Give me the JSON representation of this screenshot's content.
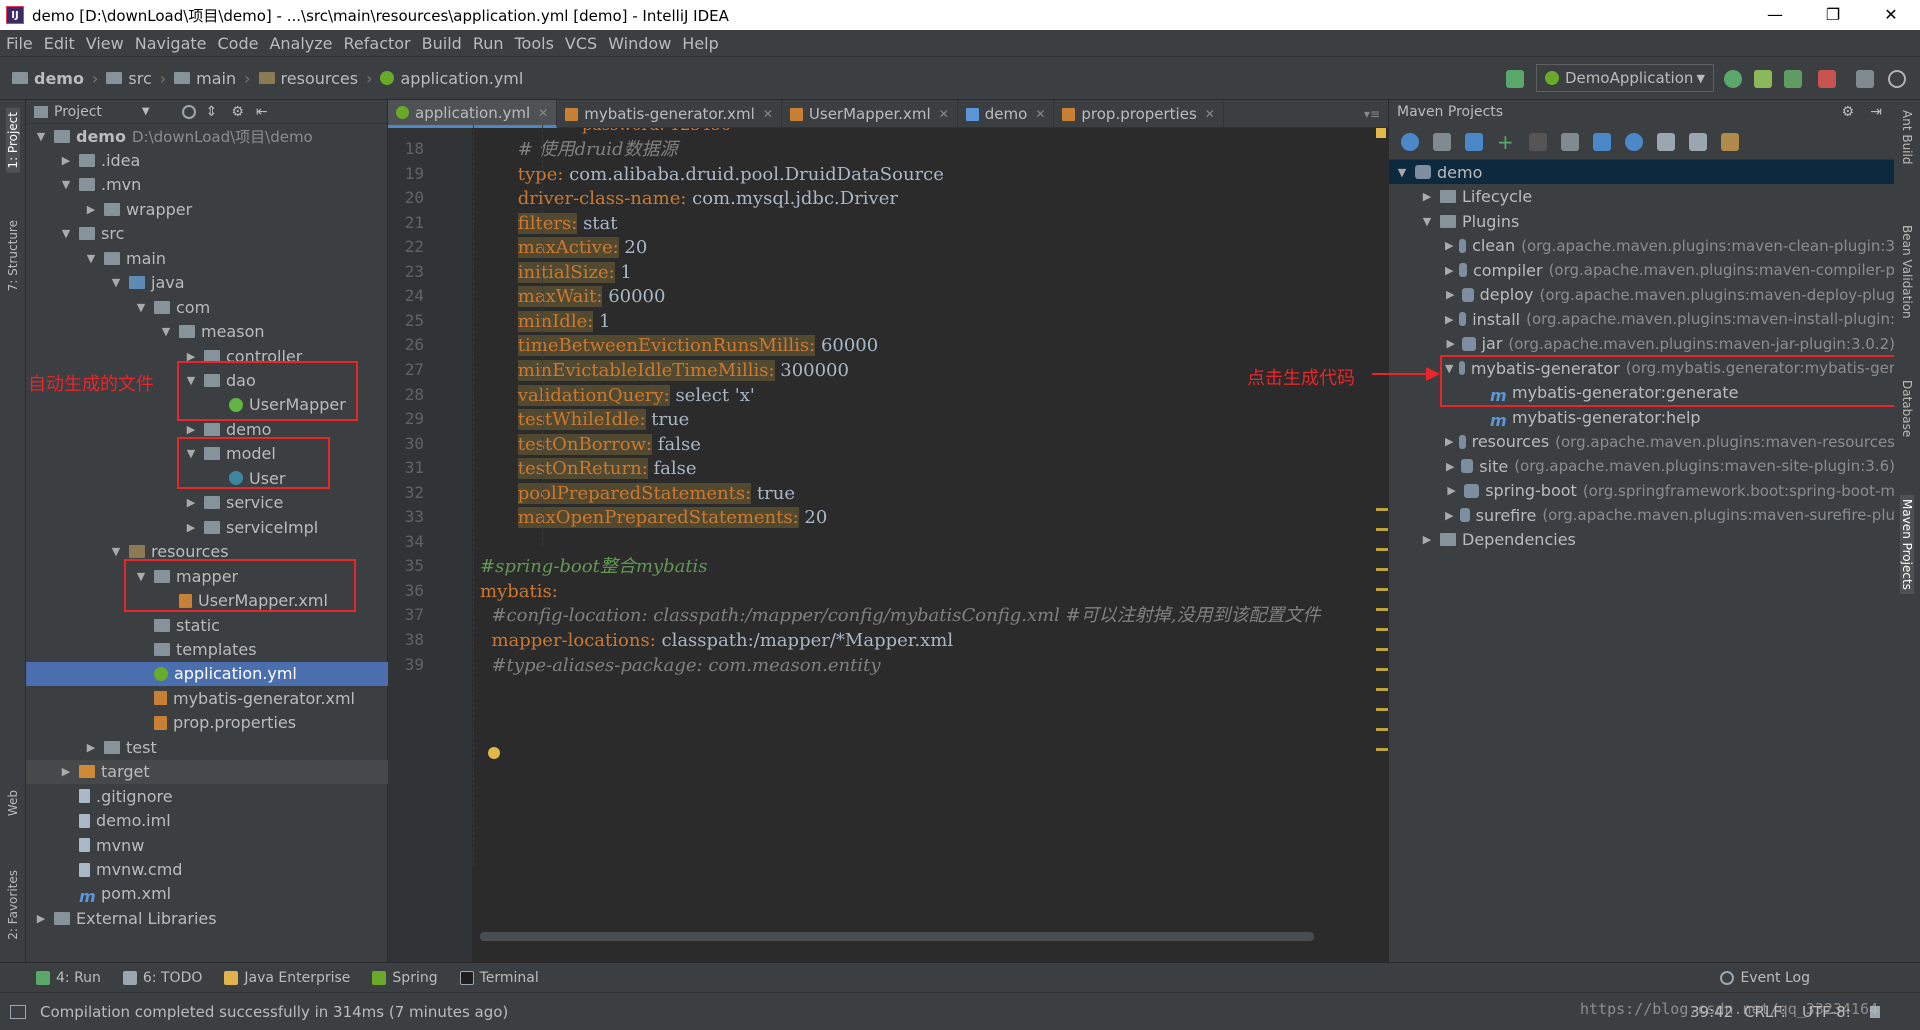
{
  "window": {
    "title": "demo [D:\\downLoad\\项目\\demo] - ...\\src\\main\\resources\\application.yml [demo] - IntelliJ IDEA",
    "controls": [
      "—",
      "❐",
      "✕"
    ]
  },
  "menu": [
    "File",
    "Edit",
    "View",
    "Navigate",
    "Code",
    "Analyze",
    "Refactor",
    "Build",
    "Run",
    "Tools",
    "VCS",
    "Window",
    "Help"
  ],
  "breadcrumb": [
    "demo",
    "src",
    "main",
    "resources",
    "application.yml"
  ],
  "run_config": "DemoApplication",
  "left_stripe": [
    "1: Project",
    "7: Structure",
    "Web",
    "2: Favorites"
  ],
  "project": {
    "header": "Project",
    "tree": [
      {
        "label": "demo",
        "extra": "D:\\downLoad\\项目\\demo",
        "arrow": "▼",
        "icon": "folder"
      },
      {
        "label": ".idea",
        "arrow": "▶",
        "icon": "folder"
      },
      {
        "label": ".mvn",
        "arrow": "▼",
        "icon": "folder"
      },
      {
        "label": "wrapper",
        "arrow": "▶",
        "icon": "folder"
      },
      {
        "label": "src",
        "arrow": "▼",
        "icon": "folder"
      },
      {
        "label": "main",
        "arrow": "▼",
        "icon": "folder"
      },
      {
        "label": "java",
        "arrow": "▼",
        "icon": "src"
      },
      {
        "label": "com",
        "arrow": "▼",
        "icon": "folder"
      },
      {
        "label": "meason",
        "arrow": "▼",
        "icon": "folder"
      },
      {
        "label": "controller",
        "arrow": "▶",
        "icon": "folder"
      },
      {
        "label": "dao",
        "arrow": "▼",
        "icon": "folder"
      },
      {
        "label": "UserMapper",
        "arrow": "",
        "icon": "iface"
      },
      {
        "label": "demo",
        "arrow": "▶",
        "icon": "folder"
      },
      {
        "label": "model",
        "arrow": "▼",
        "icon": "folder"
      },
      {
        "label": "User",
        "arrow": "",
        "icon": "class"
      },
      {
        "label": "service",
        "arrow": "▶",
        "icon": "folder"
      },
      {
        "label": "serviceImpl",
        "arrow": "▶",
        "icon": "folder"
      },
      {
        "label": "resources",
        "arrow": "▼",
        "icon": "res"
      },
      {
        "label": "mapper",
        "arrow": "▼",
        "icon": "folder"
      },
      {
        "label": "UserMapper.xml",
        "arrow": "",
        "icon": "xml"
      },
      {
        "label": "static",
        "arrow": "",
        "icon": "folder"
      },
      {
        "label": "templates",
        "arrow": "",
        "icon": "folder"
      },
      {
        "label": "application.yml",
        "arrow": "",
        "icon": "yml"
      },
      {
        "label": "mybatis-generator.xml",
        "arrow": "",
        "icon": "xml"
      },
      {
        "label": "prop.properties",
        "arrow": "",
        "icon": "xml"
      },
      {
        "label": "test",
        "arrow": "▶",
        "icon": "folder"
      },
      {
        "label": "target",
        "arrow": "▶",
        "icon": "target"
      },
      {
        "label": ".gitignore",
        "arrow": "",
        "icon": "file"
      },
      {
        "label": "demo.iml",
        "arrow": "",
        "icon": "file"
      },
      {
        "label": "mvnw",
        "arrow": "",
        "icon": "file"
      },
      {
        "label": "mvnw.cmd",
        "arrow": "",
        "icon": "file"
      },
      {
        "label": "pom.xml",
        "arrow": "",
        "icon": "m"
      },
      {
        "label": "External Libraries",
        "arrow": "▶",
        "icon": "lib"
      }
    ]
  },
  "annotations": {
    "left_note": "自动生成的文件",
    "right_note": "点击生成代码"
  },
  "editor": {
    "tabs": [
      {
        "label": "application.yml",
        "active": true
      },
      {
        "label": "mybatis-generator.xml",
        "active": false
      },
      {
        "label": "UserMapper.xml",
        "active": false
      },
      {
        "label": "demo",
        "active": false
      },
      {
        "label": "prop.properties",
        "active": false
      }
    ],
    "partial_top_line": "password: 123456",
    "line_numbers": [
      "18",
      "19",
      "20",
      "21",
      "22",
      "23",
      "24",
      "25",
      "26",
      "27",
      "28",
      "29",
      "30",
      "31",
      "32",
      "33",
      "34",
      "35",
      "36",
      "37",
      "38",
      "39"
    ],
    "lines": [
      {
        "indent": "        ",
        "comment": "# 使用druid数据源"
      },
      {
        "indent": "        ",
        "key": "type:",
        "value": " com.alibaba.druid.pool.DruidDataSource"
      },
      {
        "indent": "        ",
        "key": "driver-class-name:",
        "value": " com.mysql.jdbc.Driver"
      },
      {
        "indent": "        ",
        "key": "filters:",
        "value": " stat"
      },
      {
        "indent": "        ",
        "key": "maxActive:",
        "value": " 20"
      },
      {
        "indent": "        ",
        "key": "initialSize:",
        "value": " 1"
      },
      {
        "indent": "        ",
        "key": "maxWait:",
        "value": " 60000"
      },
      {
        "indent": "        ",
        "key": "minIdle:",
        "value": " 1"
      },
      {
        "indent": "        ",
        "key": "timeBetweenEvictionRunsMillis:",
        "value": " 60000"
      },
      {
        "indent": "        ",
        "key": "minEvictableIdleTimeMillis:",
        "value": " 300000"
      },
      {
        "indent": "        ",
        "key": "validationQuery:",
        "value": " select 'x'"
      },
      {
        "indent": "        ",
        "key": "testWhileIdle:",
        "value": " true"
      },
      {
        "indent": "        ",
        "key": "testOnBorrow:",
        "value": " false"
      },
      {
        "indent": "        ",
        "key": "testOnReturn:",
        "value": " false"
      },
      {
        "indent": "        ",
        "key": "poolPreparedStatements:",
        "value": " true"
      },
      {
        "indent": "        ",
        "key": "maxOpenPreparedStatements:",
        "value": " 20"
      },
      {
        "indent": "",
        "value": ""
      },
      {
        "indent": "",
        "comment": "#spring-boot整合mybatis"
      },
      {
        "indent": "",
        "key": "mybatis:",
        "value": ""
      },
      {
        "indent": "  ",
        "comment": "#config-location: classpath:/mapper/config/mybatisConfig.xml #可以注射掉,没用到该配置文件"
      },
      {
        "indent": "  ",
        "key": "mapper-locations:",
        "value": " classpath:/mapper/*Mapper.xml"
      },
      {
        "indent": "  ",
        "comment": "#type-aliases-package: com.meason.entity"
      }
    ]
  },
  "maven": {
    "header": "Maven Projects",
    "tree": [
      {
        "label": "demo",
        "arrow": "▼",
        "dim": ""
      },
      {
        "label": "Lifecycle",
        "arrow": "▶",
        "dim": ""
      },
      {
        "label": "Plugins",
        "arrow": "▼",
        "dim": ""
      },
      {
        "label": "clean",
        "arrow": "▶",
        "dim": "(org.apache.maven.plugins:maven-clean-plugin:3"
      },
      {
        "label": "compiler",
        "arrow": "▶",
        "dim": "(org.apache.maven.plugins:maven-compiler-p"
      },
      {
        "label": "deploy",
        "arrow": "▶",
        "dim": "(org.apache.maven.plugins:maven-deploy-plug"
      },
      {
        "label": "install",
        "arrow": "▶",
        "dim": "(org.apache.maven.plugins:maven-install-plugin:"
      },
      {
        "label": "jar",
        "arrow": "▶",
        "dim": "(org.apache.maven.plugins:maven-jar-plugin:3.0.2)"
      },
      {
        "label": "mybatis-generator",
        "arrow": "▼",
        "dim": "(org.mybatis.generator:mybatis-ger"
      },
      {
        "label": "mybatis-generator:generate",
        "arrow": "",
        "dim": ""
      },
      {
        "label": "mybatis-generator:help",
        "arrow": "",
        "dim": ""
      },
      {
        "label": "resources",
        "arrow": "▶",
        "dim": "(org.apache.maven.plugins:maven-resources"
      },
      {
        "label": "site",
        "arrow": "▶",
        "dim": "(org.apache.maven.plugins:maven-site-plugin:3.6)"
      },
      {
        "label": "spring-boot",
        "arrow": "▶",
        "dim": "(org.springframework.boot:spring-boot-m"
      },
      {
        "label": "surefire",
        "arrow": "▶",
        "dim": "(org.apache.maven.plugins:maven-surefire-plu"
      },
      {
        "label": "Dependencies",
        "arrow": "▶",
        "dim": ""
      }
    ]
  },
  "right_stripe": [
    "Ant Build",
    "Bean Validation",
    "Database",
    "Maven Projects"
  ],
  "bottom_tools": [
    {
      "label": "4: Run",
      "color": "#59a869"
    },
    {
      "label": "6: TODO",
      "color": "#9aa7b0"
    },
    {
      "label": "Java Enterprise",
      "color": "#e0b250"
    },
    {
      "label": "Spring",
      "color": "#6aaa2a"
    },
    {
      "label": "Terminal",
      "color": "#1e1e1e"
    }
  ],
  "event_log": "Event Log",
  "status": {
    "message": "Compilation completed successfully in 314ms (7 minutes ago)",
    "position": "39:42",
    "line_sep": "CRLF:",
    "encoding": "UTF-8:"
  },
  "watermark": "https://blog.csdn.net/qq_33234164",
  "colors": {
    "accent": "#4b6eaf",
    "annotation": "#e8262a",
    "yaml_key": "#cc7832",
    "comment": "#629755"
  }
}
